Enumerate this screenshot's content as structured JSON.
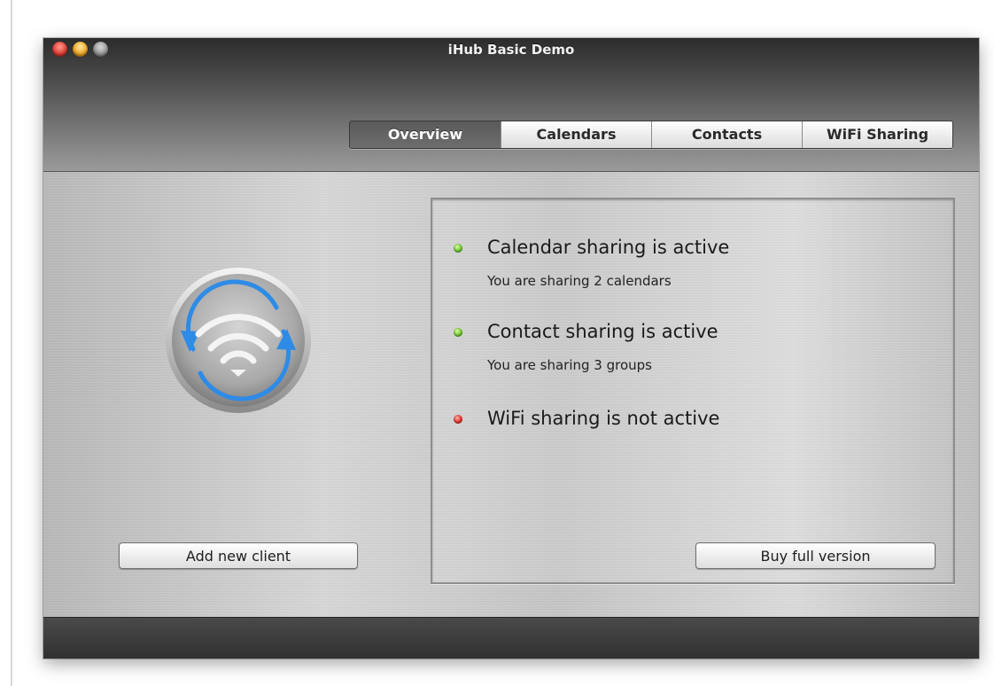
{
  "window": {
    "title": "iHub Basic Demo"
  },
  "tabs": [
    {
      "label": "Overview",
      "active": true
    },
    {
      "label": "Calendars",
      "active": false
    },
    {
      "label": "Contacts",
      "active": false
    },
    {
      "label": "WiFi Sharing",
      "active": false
    }
  ],
  "left": {
    "icon": "wifi-sync-icon",
    "add_button_label": "Add new client"
  },
  "status": [
    {
      "title": "Calendar sharing is active",
      "detail": "You are sharing 2 calendars",
      "state": "active",
      "color": "#6cc531"
    },
    {
      "title": "Contact sharing is active",
      "detail": "You are sharing 3 groups",
      "state": "active",
      "color": "#6cc531"
    },
    {
      "title": "WiFi sharing is not active",
      "detail": "",
      "state": "inactive",
      "color": "#e0322c"
    }
  ],
  "panel": {
    "buy_button_label": "Buy full version"
  },
  "colors": {
    "accent_blue": "#2e8be6",
    "active_green": "#6cc531",
    "inactive_red": "#e0322c"
  }
}
